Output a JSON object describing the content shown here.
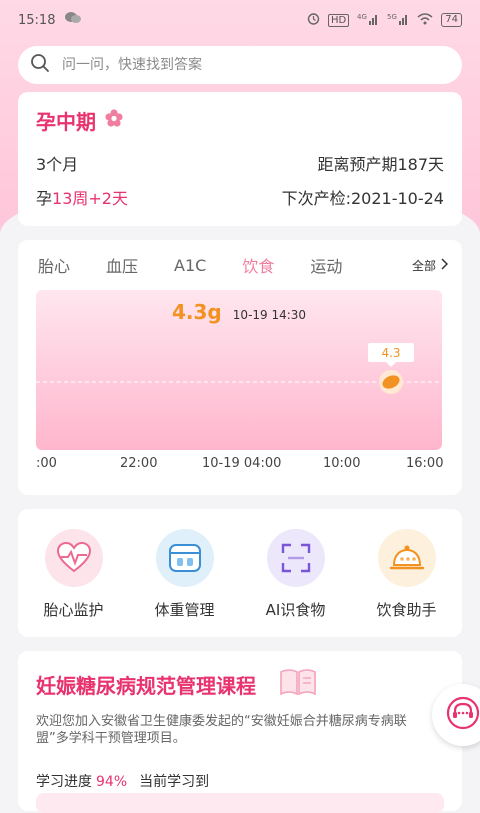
{
  "status_bar": {
    "time": "15:18",
    "battery": "74"
  },
  "search": {
    "placeholder": "问一问，快速找到答案"
  },
  "pregnancy": {
    "title": "孕中期",
    "months": "3个月",
    "countdown": "距离预产期187天",
    "week_prefix": "孕",
    "week_value": "13周+2天",
    "next_checkup": "下次产检:2021-10-24"
  },
  "chart_tabs": {
    "items": [
      "胎心",
      "血压",
      "A1C",
      "饮食",
      "运动"
    ],
    "active": "饮食",
    "all_label": "全部"
  },
  "chart_data": {
    "type": "line",
    "title": "",
    "xlabel": "",
    "ylabel": "",
    "x_tick_labels": [
      ":00",
      "22:00",
      "10-19 04:00",
      "10:00",
      "16:00"
    ],
    "series": [
      {
        "points": [
          {
            "time": "10-19 14:30",
            "value": 4.3
          }
        ]
      }
    ],
    "selected": {
      "value": "4.3",
      "unit": "g",
      "time": "10-19 14:30",
      "tooltip": "4.3"
    },
    "grid": false,
    "colors": {
      "background_top": "#ffe6ef",
      "background_bottom": "#ffb6cd",
      "marker": "#f29222"
    }
  },
  "menu": {
    "items": [
      {
        "label": "胎心监护",
        "icon": "heartbeat-icon",
        "color": "#fde3ea"
      },
      {
        "label": "体重管理",
        "icon": "scale-icon",
        "color": "#dff0fb"
      },
      {
        "label": "AI识食物",
        "icon": "scan-icon",
        "color": "#ece7fb"
      },
      {
        "label": "饮食助手",
        "icon": "food-cloche-icon",
        "color": "#fdf0dc"
      }
    ]
  },
  "course": {
    "title": "妊娠糖尿病规范管理课程",
    "description": "欢迎您加入安徽省卫生健康委发起的“安徽妊娠合并糖尿病专病联盟”多学科干预管理项目。",
    "progress_label": "学习进度",
    "progress_value": "94%",
    "current_label": "当前学习到"
  },
  "colors": {
    "accent": "#e8336f",
    "chart_value": "#f29222"
  }
}
